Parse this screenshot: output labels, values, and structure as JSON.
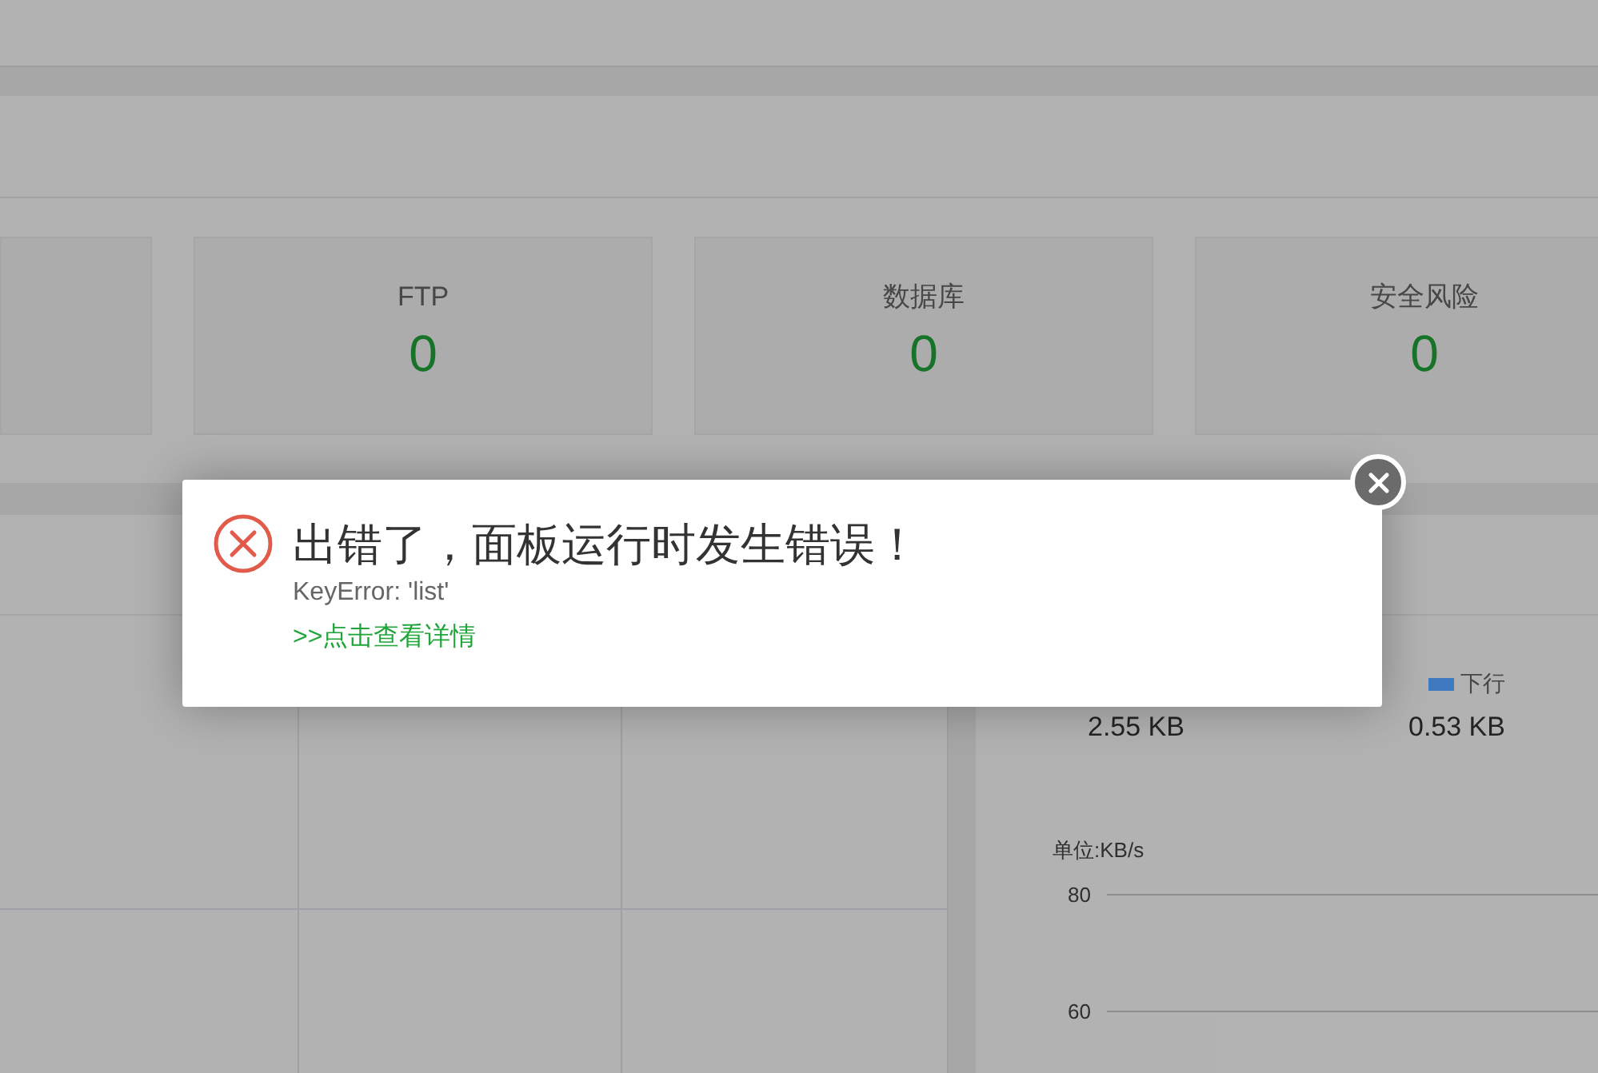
{
  "stats": [
    {
      "label": "FTP",
      "value": "0"
    },
    {
      "label": "数据库",
      "value": "0"
    },
    {
      "label": "安全风险",
      "value": "0"
    }
  ],
  "network": {
    "legend": [
      {
        "label": "下行",
        "color": "#3f79c0"
      }
    ],
    "readings": [
      "2.55 KB",
      "0.53 KB"
    ],
    "unit": "单位:KB/s",
    "ticks": [
      "80",
      "60"
    ]
  },
  "dialog": {
    "title": "出错了，面板运行时发生错误！",
    "message": "KeyError: 'list'",
    "link": ">>点击查看详情"
  }
}
